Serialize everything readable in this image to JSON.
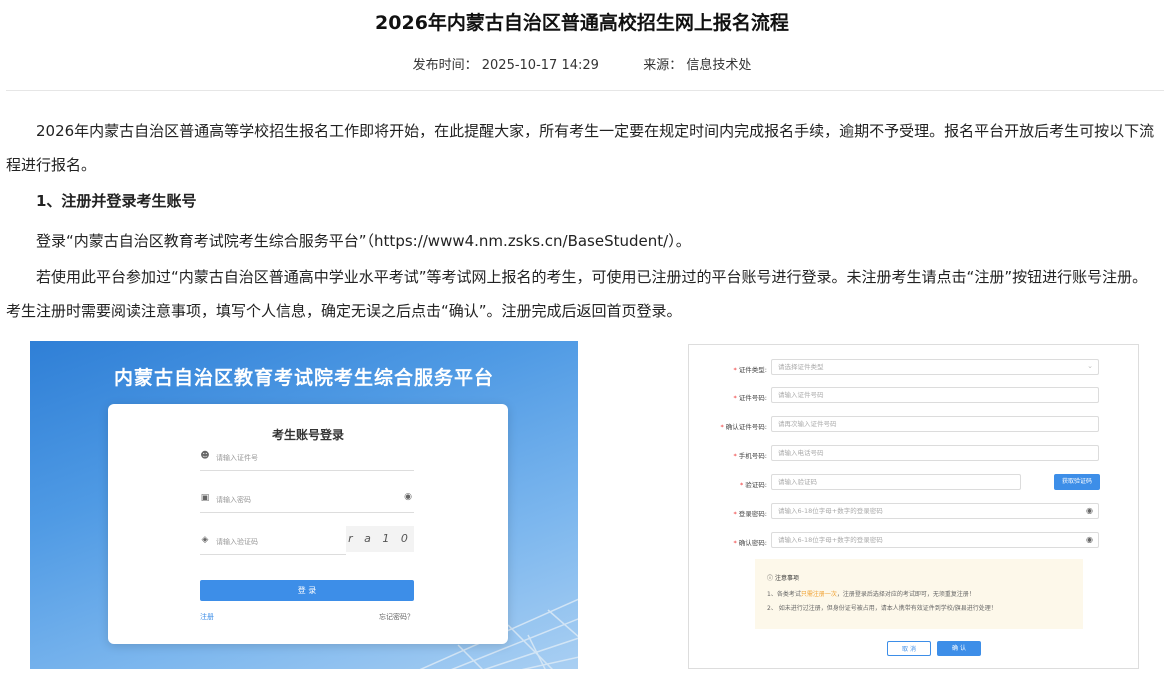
{
  "article": {
    "title": "2026年内蒙古自治区普通高校招生网上报名流程",
    "meta": {
      "publish_label": "发布时间：",
      "publish_time": "2025-10-17 14:29",
      "source_label": "来源：",
      "source": "信息技术处"
    },
    "p1": "2026年内蒙古自治区普通高等学校招生报名工作即将开始，在此提醒大家，所有考生一定要在规定时间内完成报名手续，逾期不予受理。报名平台开放后考生可按以下流程进行报名。",
    "section1_heading": "1、注册并登录考生账号",
    "p3": "登录“内蒙古自治区教育考试院考生综合服务平台”（https://www4.nm.zsks.cn/BaseStudent/）。",
    "p4": "若使用此平台参加过“内蒙古自治区普通高中学业水平考试”等考试网上报名的考生，可使用已注册过的平台账号进行登录。未注册考生请点击“注册”按钮进行账号注册。考生注册时需要阅读注意事项，填写个人信息，确定无误之后点击“确认”。注册完成后返回首页登录。"
  },
  "login_screenshot": {
    "platform_title": "内蒙古自治区教育考试院考生综合服务平台",
    "card_title": "考生账号登录",
    "id_placeholder": "请输入证件号",
    "password_placeholder": "请输入密码",
    "captcha_placeholder": "请输入验证码",
    "captcha_text": "r a 1 0",
    "login_button": "登 录",
    "register_link": "注册",
    "forgot_link": "忘记密码？",
    "icons": {
      "user": "user-icon",
      "lock": "lock-icon",
      "shield": "shield-icon",
      "eye": "eye-icon"
    }
  },
  "register_screenshot": {
    "fields": [
      {
        "label": "证件类型:",
        "placeholder": "请选择证件类型"
      },
      {
        "label": "证件号码:",
        "placeholder": "请输入证件号码"
      },
      {
        "label": "确认证件号码:",
        "placeholder": "请再次输入证件号码"
      },
      {
        "label": "手机号码:",
        "placeholder": "请输入电话号码"
      },
      {
        "label": "验证码:",
        "placeholder": "请输入验证码"
      },
      {
        "label": "登录密码:",
        "placeholder": "请输入6-18位字母+数字的登录密码"
      },
      {
        "label": "确认密码:",
        "placeholder": "请输入6-18位字母+数字的登录密码"
      }
    ],
    "get_code_button": "获取验证码",
    "notice": {
      "title": "注意事项",
      "item1_prefix": "1、各类考试",
      "item1_highlight": "只需注册一次",
      "item1_suffix": "，注册登录后选择对应的考试即可，无须重复注册！",
      "item2": "2、 如未进行过注册，但身份证号被占用，请本人携带有效证件到学校/旗县进行处理！"
    },
    "cancel_button": "取 消",
    "confirm_button": "确 认"
  }
}
